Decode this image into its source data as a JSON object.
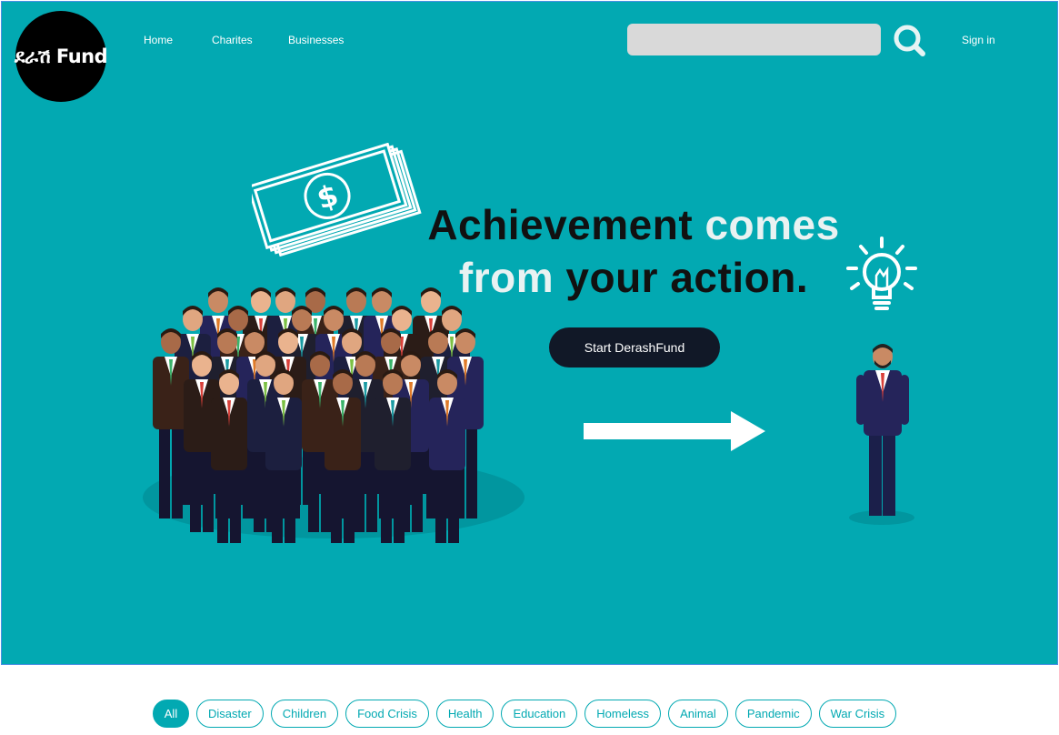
{
  "brand": {
    "logo_text": "ደራሽ Fund"
  },
  "nav": {
    "home": "Home",
    "charities": "Charites",
    "businesses": "Businesses"
  },
  "search": {
    "placeholder": ""
  },
  "auth": {
    "signin": "Sign in"
  },
  "hero": {
    "line1_dark": "Achievement",
    "line1_light": "comes",
    "line2_light": "from",
    "line2_dark": "your action.",
    "cta": "Start DerashFund"
  },
  "filters": [
    "All",
    "Disaster",
    "Children",
    "Food Crisis",
    "Health",
    "Education",
    "Homeless",
    "Animal",
    "Pandemic",
    "War Crisis"
  ],
  "colors": {
    "accent": "#02a9b2",
    "button_dark": "#111827",
    "search_bg": "#d9d9d9"
  }
}
